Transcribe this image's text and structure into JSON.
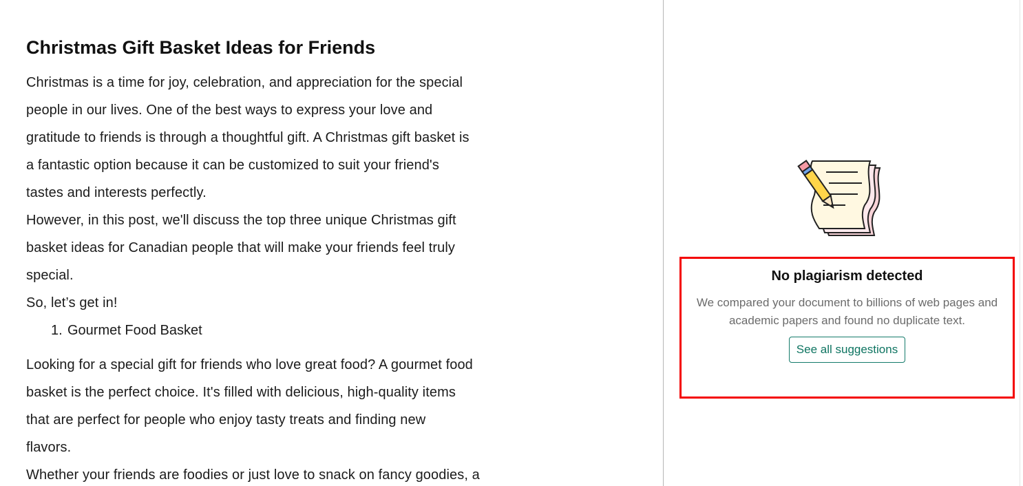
{
  "document": {
    "title": "Christmas Gift Basket Ideas for Friends",
    "intro_lines": [
      "Christmas is a time for joy, celebration, and appreciation for the special",
      "people in our lives. One of the best ways to express your love and",
      "gratitude to friends is through a thoughtful gift. A Christmas gift basket is",
      "a fantastic option because it can be customized to suit your friend's",
      "tastes and interests perfectly.",
      "However, in this post, we'll discuss the top three unique Christmas gift",
      "basket ideas for Canadian people that will make your friends feel truly",
      "special.",
      "So, let’s get in!"
    ],
    "list": [
      {
        "number": "1.",
        "text": "Gourmet Food Basket"
      }
    ],
    "body_lines": [
      "Looking for a special gift for friends who love great food? A gourmet food",
      "basket is the perfect choice. It's filled with delicious, high-quality items",
      "that are perfect for people who enjoy tasty treats and finding new",
      "flavors.",
      "Whether your friends are foodies or just love to snack on fancy goodies, a"
    ]
  },
  "plagiarism_panel": {
    "illustration_icon": "pencil-notepad-icon",
    "title": "No plagiarism detected",
    "description": "We compared your document to billions of web pages and academic papers and found no duplicate text.",
    "button_label": "See all suggestions"
  },
  "colors": {
    "highlight_border": "#f40000",
    "accent_green": "#0e7461",
    "text_dark": "#111111",
    "text_muted": "#6b6b6b"
  }
}
